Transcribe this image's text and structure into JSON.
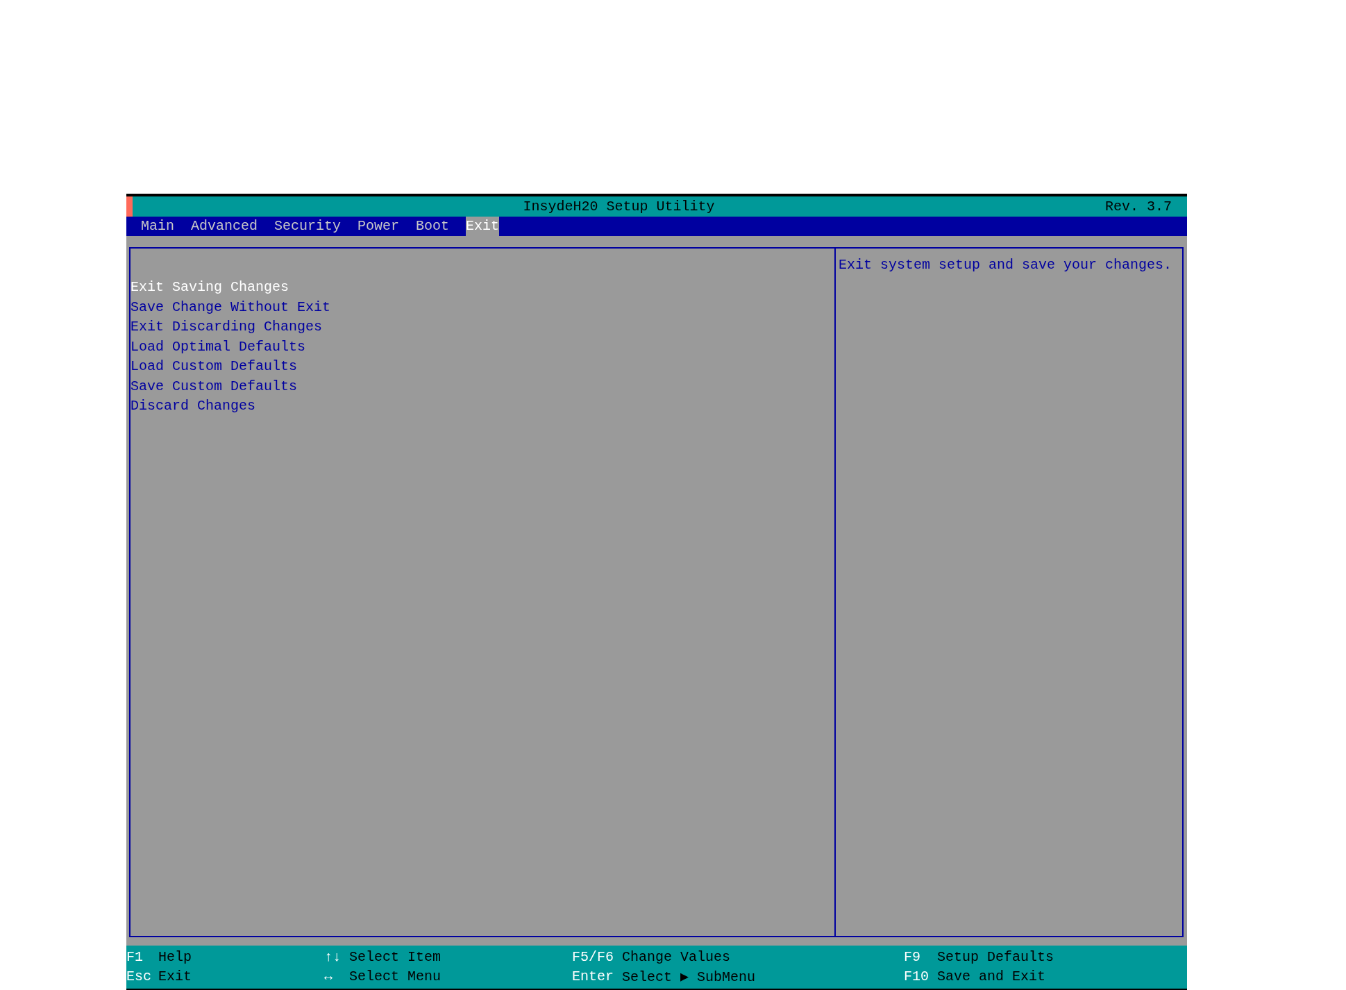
{
  "title_bar": {
    "title": "InsydeH20 Setup Utility",
    "revision": "Rev. 3.7"
  },
  "tabs": [
    {
      "label": "Main",
      "selected": false
    },
    {
      "label": "Advanced",
      "selected": false
    },
    {
      "label": "Security",
      "selected": false
    },
    {
      "label": "Power",
      "selected": false
    },
    {
      "label": "Boot",
      "selected": false
    },
    {
      "label": "Exit",
      "selected": true
    }
  ],
  "menu_items": [
    {
      "label": "Exit Saving Changes",
      "selected": true
    },
    {
      "label": "Save Change Without Exit",
      "selected": false
    },
    {
      "label": "Exit Discarding Changes",
      "selected": false
    },
    {
      "label": "Load Optimal Defaults",
      "selected": false
    },
    {
      "label": "Load Custom Defaults",
      "selected": false
    },
    {
      "label": "Save Custom Defaults",
      "selected": false
    },
    {
      "label": "Discard Changes",
      "selected": false
    }
  ],
  "help_text": "Exit system setup and save your changes.",
  "footer": [
    {
      "key": "F1",
      "action": "Help"
    },
    {
      "key": "Esc",
      "action": "Exit"
    },
    {
      "key": "↑↓",
      "action": "Select Item"
    },
    {
      "key": "↔",
      "action": "Select Menu"
    },
    {
      "key": "F5/F6",
      "action": "Change Values"
    },
    {
      "key": "Enter",
      "action": "Select ▶ SubMenu"
    },
    {
      "key": "F9",
      "action": "Setup Defaults"
    },
    {
      "key": "F10",
      "action": "Save and Exit"
    }
  ]
}
